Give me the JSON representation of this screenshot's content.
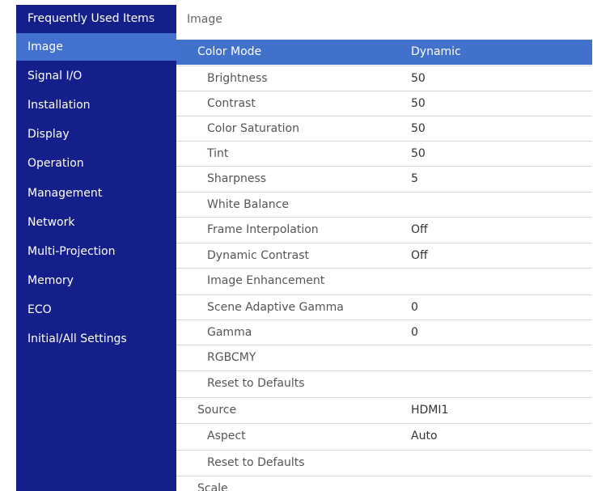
{
  "sidebar": {
    "items": [
      {
        "label": "Frequently Used Items"
      },
      {
        "label": "Image"
      },
      {
        "label": "Signal I/O"
      },
      {
        "label": "Installation"
      },
      {
        "label": "Display"
      },
      {
        "label": "Operation"
      },
      {
        "label": "Management"
      },
      {
        "label": "Network"
      },
      {
        "label": "Multi-Projection"
      },
      {
        "label": "Memory"
      },
      {
        "label": "ECO"
      },
      {
        "label": "Initial/All Settings"
      }
    ],
    "active": "Image"
  },
  "main": {
    "title": "Image",
    "rows": [
      {
        "label": "Color Mode",
        "value": "Dynamic"
      },
      {
        "label": "Brightness",
        "value": "50"
      },
      {
        "label": "Contrast",
        "value": "50"
      },
      {
        "label": "Color Saturation",
        "value": "50"
      },
      {
        "label": "Tint",
        "value": "50"
      },
      {
        "label": "Sharpness",
        "value": "5"
      },
      {
        "label": "White Balance",
        "value": ""
      },
      {
        "label": "Frame Interpolation",
        "value": "Off"
      },
      {
        "label": "Dynamic Contrast",
        "value": "Off"
      },
      {
        "label": "Image Enhancement",
        "value": ""
      },
      {
        "label": "Scene Adaptive Gamma",
        "value": "0"
      },
      {
        "label": "Gamma",
        "value": "0"
      },
      {
        "label": "RGBCMY",
        "value": ""
      },
      {
        "label": "Reset to Defaults",
        "value": ""
      },
      {
        "label": "Source",
        "value": "HDMI1"
      },
      {
        "label": "Aspect",
        "value": "Auto"
      },
      {
        "label": "Reset to Defaults",
        "value": ""
      },
      {
        "label": "Scale",
        "value": ""
      }
    ],
    "selected": "Color Mode"
  },
  "colors": {
    "sidebar_bg": "#151f8c",
    "active_bg": "#4371cf",
    "selected_row_bg": "#4271cc"
  }
}
